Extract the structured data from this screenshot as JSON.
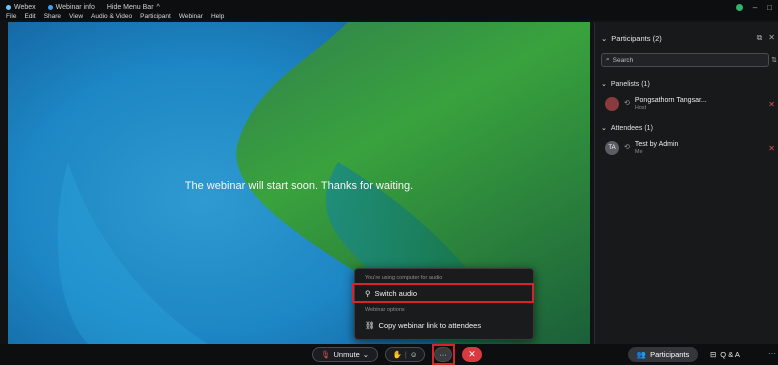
{
  "titlebar": {
    "app_name": "Webex",
    "webinar_info": "Webinar info",
    "hide_menu": "Hide Menu Bar",
    "hide_menu_caret": "^",
    "menu": [
      "File",
      "Edit",
      "Share",
      "View",
      "Audio & Video",
      "Participant",
      "Webinar",
      "Help"
    ],
    "minimize": "–",
    "maximize": "□"
  },
  "stage": {
    "message": "The webinar will start soon. Thanks for waiting."
  },
  "panel": {
    "title": "Participants (2)",
    "search_placeholder": "Search",
    "groups": [
      {
        "label": "Panelists (1)",
        "people": [
          {
            "initials": "",
            "name": "Pongsathorn Tangsar...",
            "role": "Host",
            "avatar_color": "#8a3b3b"
          }
        ]
      },
      {
        "label": "Attendees (1)",
        "people": [
          {
            "initials": "TA",
            "name": "Test by Admin",
            "role": "Me",
            "avatar_color": "#5a5d63"
          }
        ]
      }
    ]
  },
  "popup": {
    "section1": "You're using computer for audio",
    "switch_audio": "Switch audio",
    "section2": "Webinar options",
    "copy_link": "Copy webinar link to attendees"
  },
  "toolbar": {
    "unmute_label": "Unmute",
    "more_label": "···",
    "leave_label": "✕",
    "participants_label": "Participants",
    "qa_label": "Q & A",
    "more_right": "···"
  },
  "colors": {
    "highlight": "#d9222a",
    "leave": "#d93a40",
    "mute_red": "#d9534f"
  }
}
